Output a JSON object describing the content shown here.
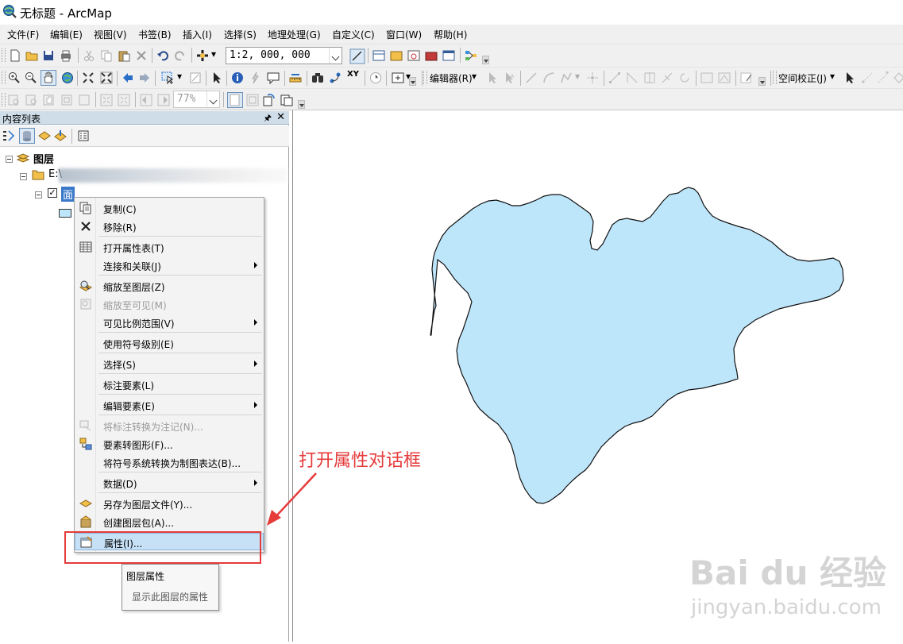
{
  "window": {
    "title": "无标题 - ArcMap"
  },
  "menu": [
    "文件(F)",
    "编辑(E)",
    "视图(V)",
    "书签(B)",
    "插入(I)",
    "选择(S)",
    "地理处理(G)",
    "自定义(C)",
    "窗口(W)",
    "帮助(H)"
  ],
  "toolbar": {
    "scale": "1:2, 000, 000",
    "editor_label": "编辑器(R)",
    "spatial_adjust_label": "空间校正(J)",
    "zoom_percent": "77%"
  },
  "toc": {
    "title": "内容列表",
    "root_label": "图层",
    "folder_label": "E:\\",
    "layer_label": "面"
  },
  "context_menu": [
    {
      "label": "复制(C)",
      "icon": "copy-icon",
      "enabled": true
    },
    {
      "label": "移除(R)",
      "icon": "remove-icon",
      "enabled": true
    },
    {
      "label": "打开属性表(T)",
      "icon": "table-icon",
      "enabled": true
    },
    {
      "label": "连接和关联(J)",
      "icon": "",
      "enabled": true,
      "submenu": true
    },
    {
      "label": "缩放至图层(Z)",
      "icon": "zoom-to-layer-icon",
      "enabled": true
    },
    {
      "label": "缩放至可见(M)",
      "icon": "zoom-visible-icon",
      "enabled": false
    },
    {
      "label": "可见比例范围(V)",
      "icon": "",
      "enabled": true,
      "submenu": true
    },
    {
      "label": "使用符号级别(E)",
      "icon": "",
      "enabled": true
    },
    {
      "label": "选择(S)",
      "icon": "",
      "enabled": true,
      "submenu": true
    },
    {
      "label": "标注要素(L)",
      "icon": "",
      "enabled": true
    },
    {
      "label": "编辑要素(E)",
      "icon": "",
      "enabled": true,
      "submenu": true
    },
    {
      "label": "将标注转换为注记(N)...",
      "icon": "convert-labels-icon",
      "enabled": false
    },
    {
      "label": "要素转图形(F)...",
      "icon": "features-to-graphics-icon",
      "enabled": true
    },
    {
      "label": "将符号系统转换为制图表达(B)...",
      "icon": "",
      "enabled": true
    },
    {
      "label": "数据(D)",
      "icon": "",
      "enabled": true,
      "submenu": true
    },
    {
      "label": "另存为图层文件(Y)...",
      "icon": "save-layer-icon",
      "enabled": true
    },
    {
      "label": "创建图层包(A)...",
      "icon": "layer-package-icon",
      "enabled": true
    },
    {
      "label": "属性(I)...",
      "icon": "properties-icon",
      "enabled": true,
      "highlighted": true
    }
  ],
  "tooltip": {
    "title": "图层属性",
    "description": "显示此图层的属性"
  },
  "annotation": "打开属性对话框",
  "watermark": {
    "brand": "Bai du 经验",
    "url": "jingyan.baidu.com"
  },
  "colors": {
    "polygon_fill": "#bee6fb",
    "accent_red": "#e53b3b",
    "highlight": "#c6e0f5"
  }
}
